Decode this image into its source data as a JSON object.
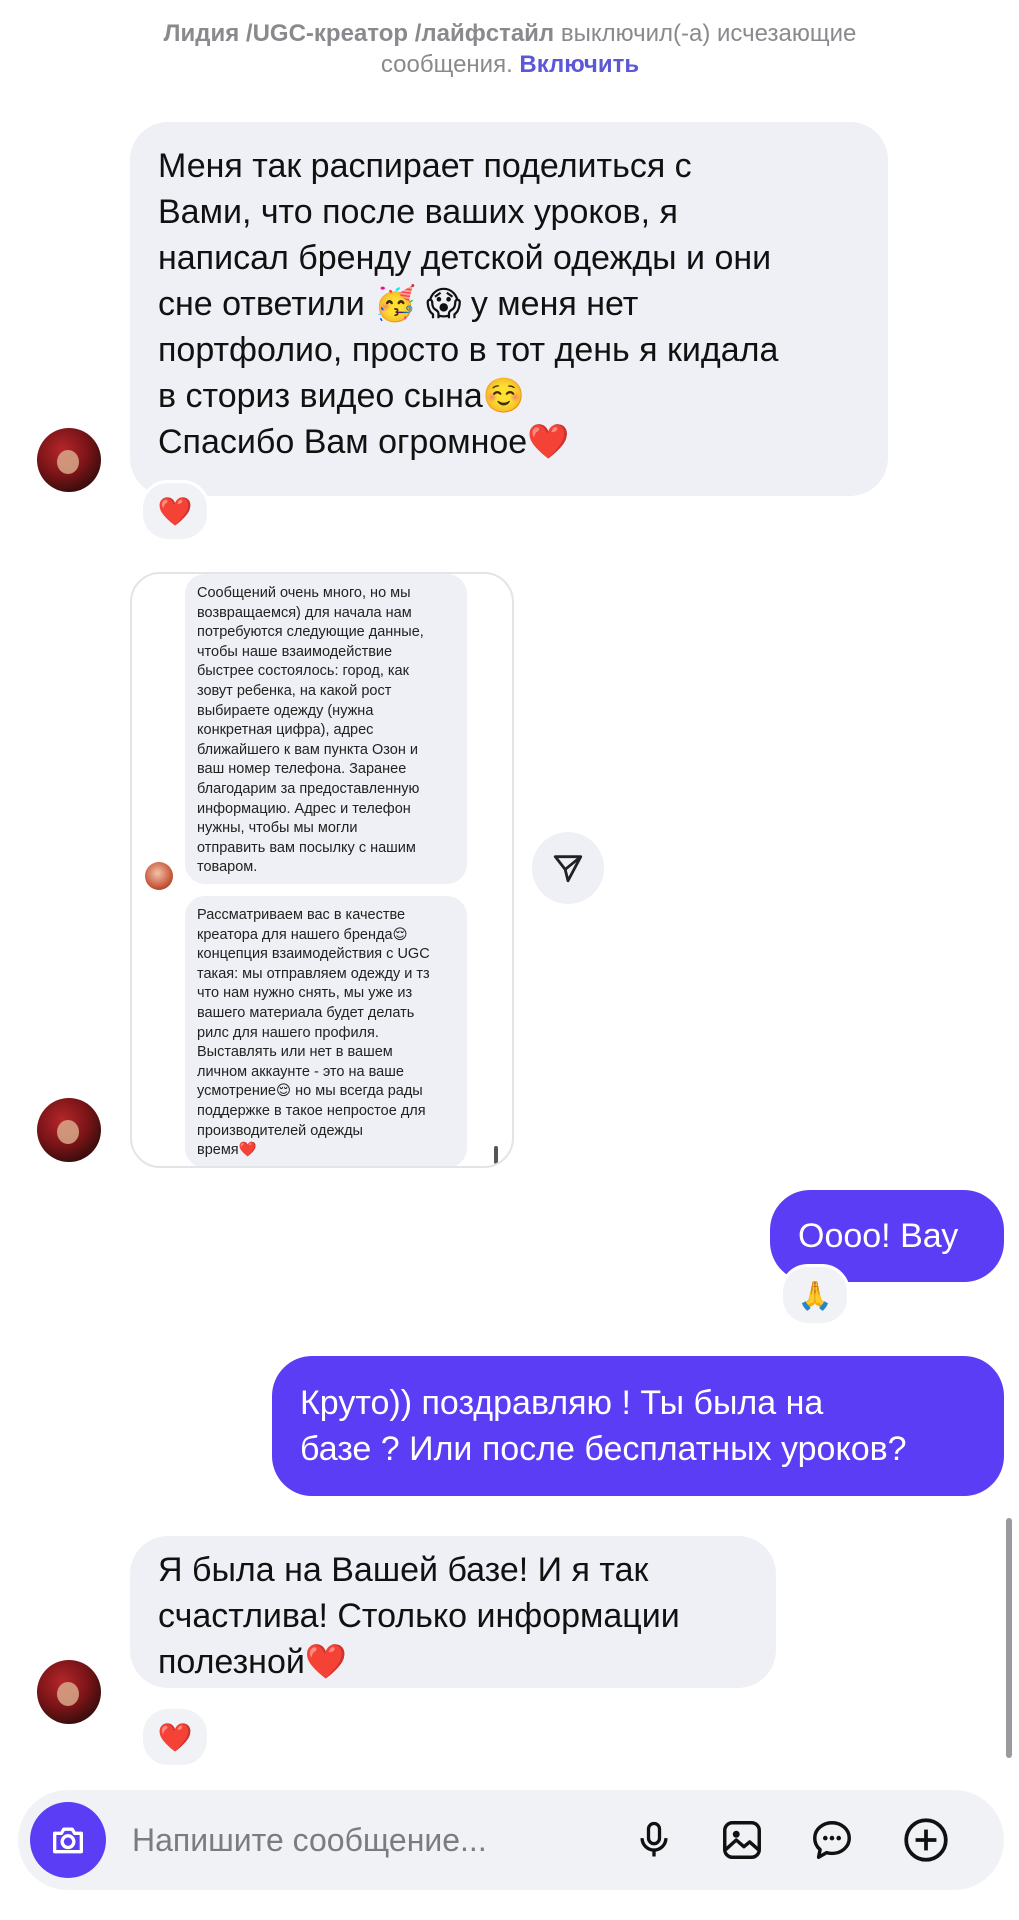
{
  "notice": {
    "name": "Лидия /UGC-креатор /лайфстайл",
    "text": " выключил(-а) исчезающие",
    "line2": "сообщения. ",
    "action": "Включить"
  },
  "messages": [
    {
      "direction": "incoming",
      "lines": [
        "Меня так распирает поделиться с",
        "Вами, что после ваших уроков, я",
        "написал бренду детской одежды и они",
        "сне ответили 🥳 😱  у меня нет",
        "портфолио, просто в тот день я кидала",
        "в сториз видео сына☺️",
        "Спасибо Вам огромное❤️"
      ],
      "reaction": "❤️"
    },
    {
      "direction": "incoming",
      "type": "shared-screenshot",
      "block1": [
        "Сообщений очень много, но мы",
        "возвращаемся) для начала нам",
        "потребуются следующие данные,",
        "чтобы наше взаимодействие",
        "быстрее состоялось: город, как",
        "зовут ребенка, на какой рост",
        "выбираете одежду (нужна",
        "конкретная цифра), адрес",
        "ближайшего к вам пункта Озон и",
        "ваш номер телефона. Заранее",
        "благодарим за предоставленную",
        "информацию. Адрес и телефон",
        "нужны, чтобы мы могли",
        "отправить вам посылку с нашим",
        "товаром."
      ],
      "block2": [
        "Рассматриваем вас в качестве",
        "креатора для нашего бренда😌",
        "концепция взаимодействия с UGC",
        "такая: мы отправляем одежду и тз",
        "что нам нужно снять, мы уже из",
        "вашего материала будет делать",
        "рилс для нашего профиля.",
        "Выставлять или нет в вашем",
        "личном аккаунте - это на ваше",
        "усмотрение😌 но мы всегда рады",
        "поддержке в такое непростое для",
        "производителей одежды",
        "время❤️"
      ]
    },
    {
      "direction": "outgoing",
      "lines": [
        "Оооо! Вау"
      ],
      "reaction": "🙏"
    },
    {
      "direction": "outgoing",
      "lines": [
        "Круто)) поздравляю ! Ты была на",
        "базе ? Или после бесплатных уроков?"
      ]
    },
    {
      "direction": "incoming",
      "lines": [
        "Я была на Вашей базе! И я так",
        "счастлива! Столько информации",
        "полезной❤️"
      ],
      "reaction": "❤️"
    }
  ],
  "composer": {
    "placeholder": "Напишите сообщение...",
    "icons": [
      "camera-icon",
      "microphone-icon",
      "gallery-icon",
      "sticker-icon",
      "plus-icon"
    ]
  },
  "colors": {
    "outgoing": "#5a3df5",
    "incoming": "#eef0f5",
    "link": "#5b57d6"
  }
}
